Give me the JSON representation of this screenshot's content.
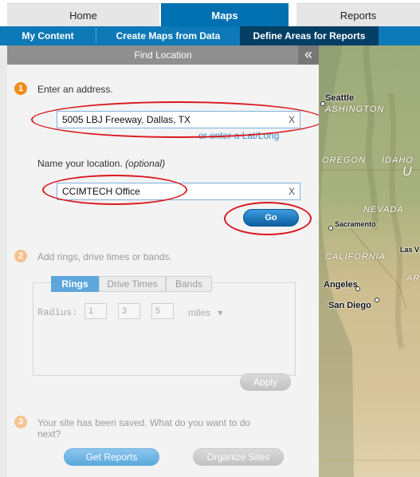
{
  "top_tabs": [
    "Home",
    "Maps",
    "Reports"
  ],
  "sub_tabs": [
    "My Content",
    "Create Maps from Data",
    "Define Areas for Reports"
  ],
  "panel": {
    "title": "Find Location",
    "collapse_glyph": "«",
    "step1": {
      "number": "1",
      "label": "Enter an address.",
      "address_value": "5005 LBJ Freeway, Dallas, TX",
      "latlong_link": "or enter a Lat/Long",
      "name_label": "Name your location.",
      "name_optional": "(optional)",
      "name_value": "CCIMTECH Office",
      "clear_glyph": "X",
      "go_label": "Go"
    },
    "step2": {
      "number": "2",
      "label": "Add rings, drive times or bands.",
      "tabs": [
        "Rings",
        "Drive Times",
        "Bands"
      ],
      "radius_label": "Radius:",
      "radius_values": [
        "1",
        "3",
        "5"
      ],
      "units_value": "miles",
      "units_caret": "▾",
      "apply_label": "Apply"
    },
    "step3": {
      "number": "3",
      "label_line1": "Your site has been saved. What do you want to do",
      "label_line2": "next?",
      "get_reports_label": "Get Reports",
      "organize_sites_label": "Organize Sites"
    }
  },
  "map": {
    "cities": [
      "Seattle",
      "Sacramento",
      "Las V",
      "Angeles",
      "San Diego"
    ],
    "states": [
      "ASHINGTON",
      "OREGON",
      "IDAHO",
      "U",
      "NEVADA",
      "CALIFORNIA",
      "AR"
    ]
  },
  "colors": {
    "accent_blue": "#0d79b6",
    "active_subtab": "#053f66",
    "step_orange": "#f08c1a",
    "annotation_red": "#d9181e"
  }
}
